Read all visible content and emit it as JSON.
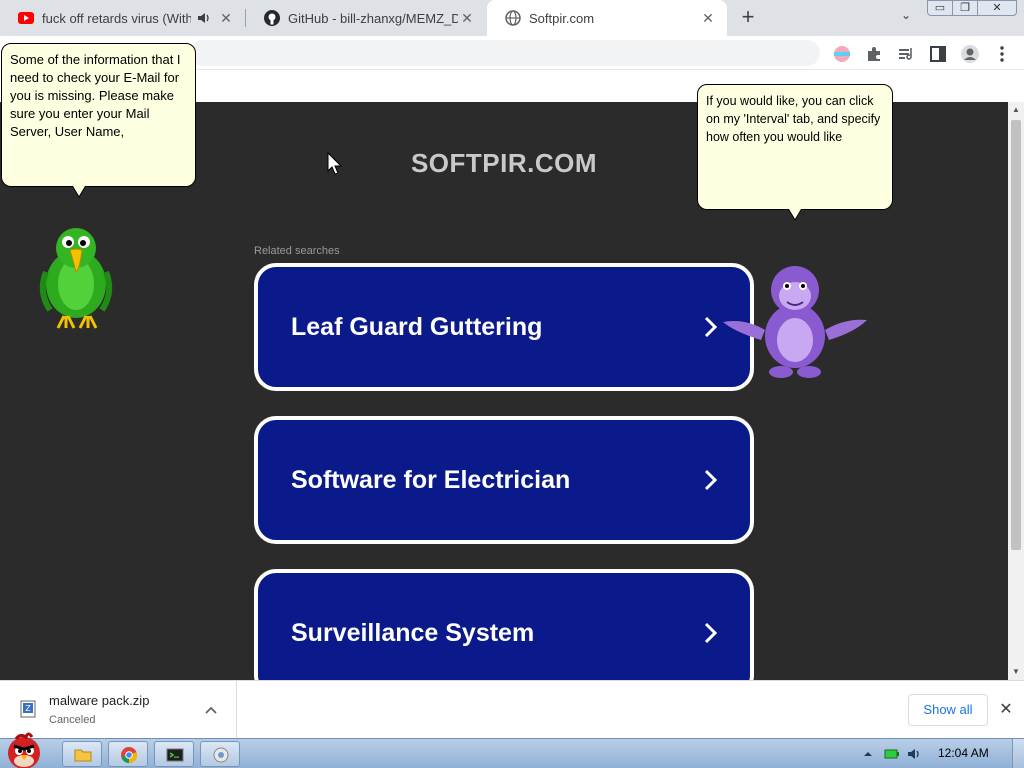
{
  "browser": {
    "tabs": [
      {
        "title": "fuck off retards virus (With",
        "favicon": "youtube-icon",
        "audio": true,
        "close": "✕"
      },
      {
        "title": "GitHub - bill-zhanxg/MEMZ_D",
        "favicon": "github-icon",
        "close": "✕"
      },
      {
        "title": "Softpir.com",
        "favicon": "globe-icon",
        "active": true,
        "close": "✕"
      }
    ],
    "new_tab": "+",
    "tab_search": "⌄",
    "window_controls": {
      "minimize": "▭",
      "maximize": "❐",
      "close": "✕"
    },
    "omnibox_value": ""
  },
  "page": {
    "site_title": "SOFTPIR.COM",
    "related_label": "Related searches",
    "results": [
      {
        "label": "Leaf Guard Guttering"
      },
      {
        "label": "Software for Electrician"
      },
      {
        "label": "Surveillance System"
      }
    ]
  },
  "agents": {
    "parrot_bubble": "Some of the information that I need to check your E-Mail for you is missing. Please make sure you enter your Mail Server, User Name,",
    "monkey_bubble": "If you would like, you can click on my 'Interval' tab, and specify how often you would like"
  },
  "scrollbar": {
    "up": "▲",
    "down": "▼"
  },
  "downloads": {
    "item_name": "malware pack.zip",
    "item_status": "Canceled",
    "show_all": "Show all",
    "close": "✕"
  },
  "taskbar": {
    "clock": "12:04 AM"
  },
  "colors": {
    "result_bg": "#0b1a8a",
    "page_bg": "#2b2b2b",
    "bubble_bg": "#ffffe1",
    "accent_link": "#1a73e8"
  }
}
